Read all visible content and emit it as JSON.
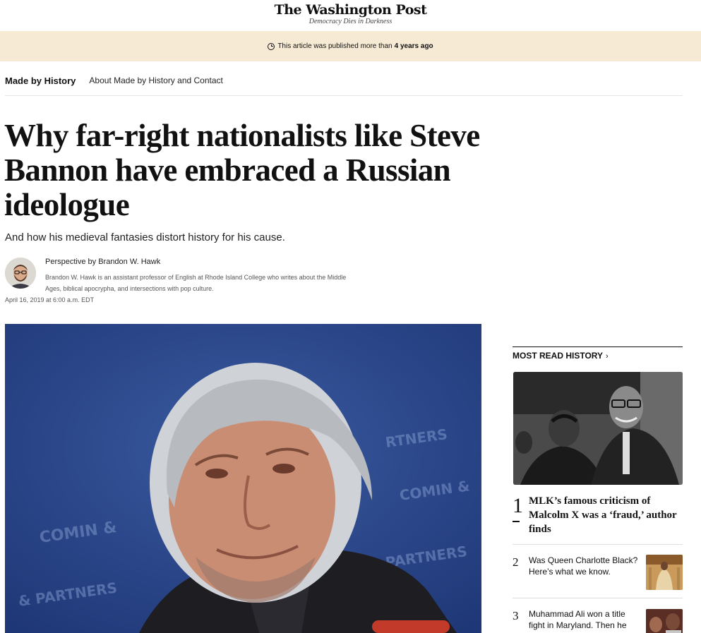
{
  "masthead": {
    "logo": "The Washington Post",
    "tagline": "Democracy Dies in Darkness"
  },
  "banner": {
    "icon": "clock-icon",
    "text": "This article was published more than",
    "emphasis": "4 years ago",
    "background": "#f7ead4"
  },
  "subnav": {
    "section": "Made by History",
    "about": "About Made by History and Contact"
  },
  "article": {
    "headline": "Why far-right nationalists like Steve Bannon have embraced a Russian ideologue",
    "dek": "And how his medieval fantasies distort history for his cause.",
    "byline": "Perspective by Brandon W. Hawk",
    "bio": "Brandon W. Hawk is an assistant professor of English at Rhode Island College who writes about the Middle Ages, biblical apocrypha, and intersections with pop culture.",
    "date": "April 16, 2019 at 6:00 a.m. EDT"
  },
  "most_read": {
    "heading": "MOST READ HISTORY",
    "chevron": "›",
    "items": [
      {
        "num": "1",
        "title": "MLK’s famous criticism of Malcolm X was a ‘fraud,’ author finds"
      },
      {
        "num": "2",
        "title": "Was Queen Charlotte Black? Here’s what we know."
      },
      {
        "num": "3",
        "title": "Muhammad Ali won a title fight in Maryland. Then he"
      }
    ]
  }
}
